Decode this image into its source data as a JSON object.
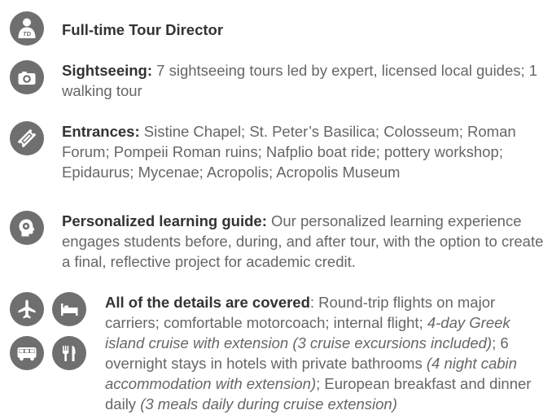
{
  "colors": {
    "icon_bg": "#6f6f6f",
    "heading": "#333333",
    "body": "#666666"
  },
  "items": [
    {
      "icon": "person-td-icon",
      "icon_text": "TD",
      "heading": "Full-time Tour Director",
      "text": ""
    },
    {
      "icon": "camera-icon",
      "heading": "Sightseeing:",
      "text": " 7 sightseeing tours led by expert, licensed local guides; 1 walking tour"
    },
    {
      "icon": "ticket-icon",
      "heading": "Entrances:",
      "text": " Sistine Chapel; St. Peter’s Basilica; Colosseum; Roman Forum; Pompeii Roman ruins; Nafplio boat ride; pottery workshop; Epidaurus; Mycenae; Acropolis; Acropolis Museum"
    },
    {
      "icon": "brain-head-icon",
      "heading": "Personalized learning guide:",
      "text": " Our personalized learning experience engages students before, during, and after tour, with the option to create a final, reflective project for academic credit."
    }
  ],
  "details": {
    "icons": [
      "airplane-icon",
      "bed-icon",
      "bus-icon",
      "utensils-icon"
    ],
    "heading": "All of the details are covered",
    "segments": [
      {
        "t": ": Round-trip flights on major carriers; comfortable motorcoach; internal flight; ",
        "i": false
      },
      {
        "t": "4-day Greek island cruise with extension (3 cruise excursions included)",
        "i": true
      },
      {
        "t": "; 6 overnight stays in hotels with private bathrooms ",
        "i": false
      },
      {
        "t": "(4 night cabin accommodation with extension)",
        "i": true
      },
      {
        "t": "; European breakfast and dinner daily ",
        "i": false
      },
      {
        "t": "(3 meals daily during cruise extension)",
        "i": true
      }
    ]
  }
}
